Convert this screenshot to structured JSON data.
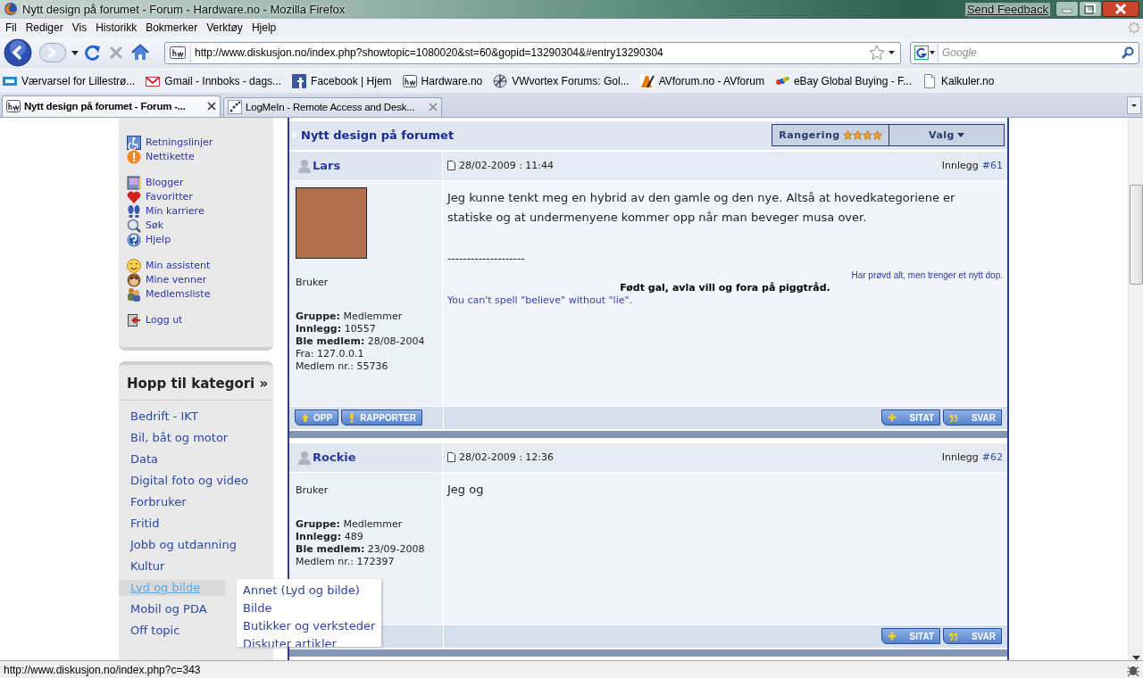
{
  "window": {
    "title": "Nytt design på forumet - Forum - Hardware.no - Mozilla Firefox",
    "feedback": "Send Feedback"
  },
  "menu": [
    "Fil",
    "Rediger",
    "Vis",
    "Historikk",
    "Bokmerker",
    "Verktøy",
    "Hjelp"
  ],
  "address": {
    "value": "http://www.diskusjon.no/index.php?showtopic=1080020&st=60&gopid=13290304&#entry13290304"
  },
  "search": {
    "placeholder": "Google"
  },
  "bookmarks": [
    "Værvarsel for Lillestrø...",
    "Gmail - Innboks - dags...",
    "Facebook | Hjem",
    "Hardware.no",
    "VWvortex Forums: Gol...",
    "AVforum.no - AVforum",
    "eBay Global Buying - F...",
    "Kalkuler.no"
  ],
  "tabs": [
    {
      "label": "Nytt design på forumet - Forum -...",
      "selected": true
    },
    {
      "label": "LogMeIn - Remote Access and Desk...",
      "selected": false
    }
  ],
  "sidebar": {
    "link_groups": [
      {
        "links": [
          "Retningslinjer",
          "Nettikette"
        ]
      },
      {
        "links": [
          "Blogger",
          "Favoritter",
          "Min karriere",
          "Søk",
          "Hjelp"
        ]
      },
      {
        "links": [
          "Min assistent",
          "Mine venner",
          "Medlemsliste"
        ]
      },
      {
        "links": [
          "Logg ut"
        ]
      }
    ]
  },
  "categories": {
    "title": "Hopp til kategori »",
    "items": [
      {
        "label": "Bedrift - IKT",
        "hovered": false
      },
      {
        "label": "Bil, båt og motor",
        "hovered": false
      },
      {
        "label": "Data",
        "hovered": false
      },
      {
        "label": "Digital foto og video",
        "hovered": false
      },
      {
        "label": "Forbruker",
        "hovered": false
      },
      {
        "label": "Fritid",
        "hovered": false
      },
      {
        "label": "Jobb og utdanning",
        "hovered": false
      },
      {
        "label": "Kultur",
        "hovered": false
      },
      {
        "label": "Lyd og bilde",
        "hovered": true
      },
      {
        "label": "Mobil og PDA",
        "hovered": false
      },
      {
        "label": "Off topic",
        "hovered": false
      }
    ],
    "submenu": [
      "Annet (Lyd og bilde)",
      "Bilde",
      "Butikker og verksteder",
      "Diskuter artikler"
    ]
  },
  "topic": {
    "title": "Nytt design på forumet",
    "rating_label": "Rangering",
    "stars": 4,
    "options": "Valg"
  },
  "posts": [
    {
      "author": "Lars",
      "date": "28/02-2009 : 11:44",
      "post_label": "Innlegg",
      "post_number": "#61",
      "avatar": true,
      "rank": "Bruker",
      "details": [
        "**Gruppe:** Medlemmer",
        "**Innlegg:** 10557",
        "**Ble medlem:** 28/08-2004",
        "Fra: 127.0.0.1",
        "Medlem nr.: 55736"
      ],
      "body": "Jeg kunne tenkt meg en hybrid av den gamle og den nye. Altså at hovedkategoriene er statiske og at undermenyene kommer opp når man beveger musa over.",
      "signature": {
        "rule": "--------------------",
        "tagline": "Har prøvd alt, men trenger et nytt dop.",
        "motto": "Født gal, avla vill og fora på piggtråd.",
        "quote": "You can't spell \"believe\" without \"lie\"."
      },
      "left_buttons": [
        {
          "label": "OPP",
          "kind": "up"
        },
        {
          "label": "RAPPORTER",
          "kind": "report"
        }
      ],
      "right_buttons": [
        {
          "label": "SITAT",
          "kind": "quote"
        },
        {
          "label": "SVAR",
          "kind": "reply"
        }
      ]
    },
    {
      "author": "Rockie",
      "date": "28/02-2009 : 12:36",
      "post_label": "Innlegg",
      "post_number": "#62",
      "avatar": false,
      "rank": "Bruker",
      "details": [
        "**Gruppe:** Medlemmer",
        "**Innlegg:** 489",
        "**Ble medlem:** 23/09-2008",
        "Medlem nr.: 172397"
      ],
      "body": "Jeg og",
      "right_buttons": [
        {
          "label": "SITAT",
          "kind": "quote"
        },
        {
          "label": "SVAR",
          "kind": "reply"
        }
      ]
    }
  ],
  "status_bar": "http://www.diskusjon.no/index.php?c=343"
}
